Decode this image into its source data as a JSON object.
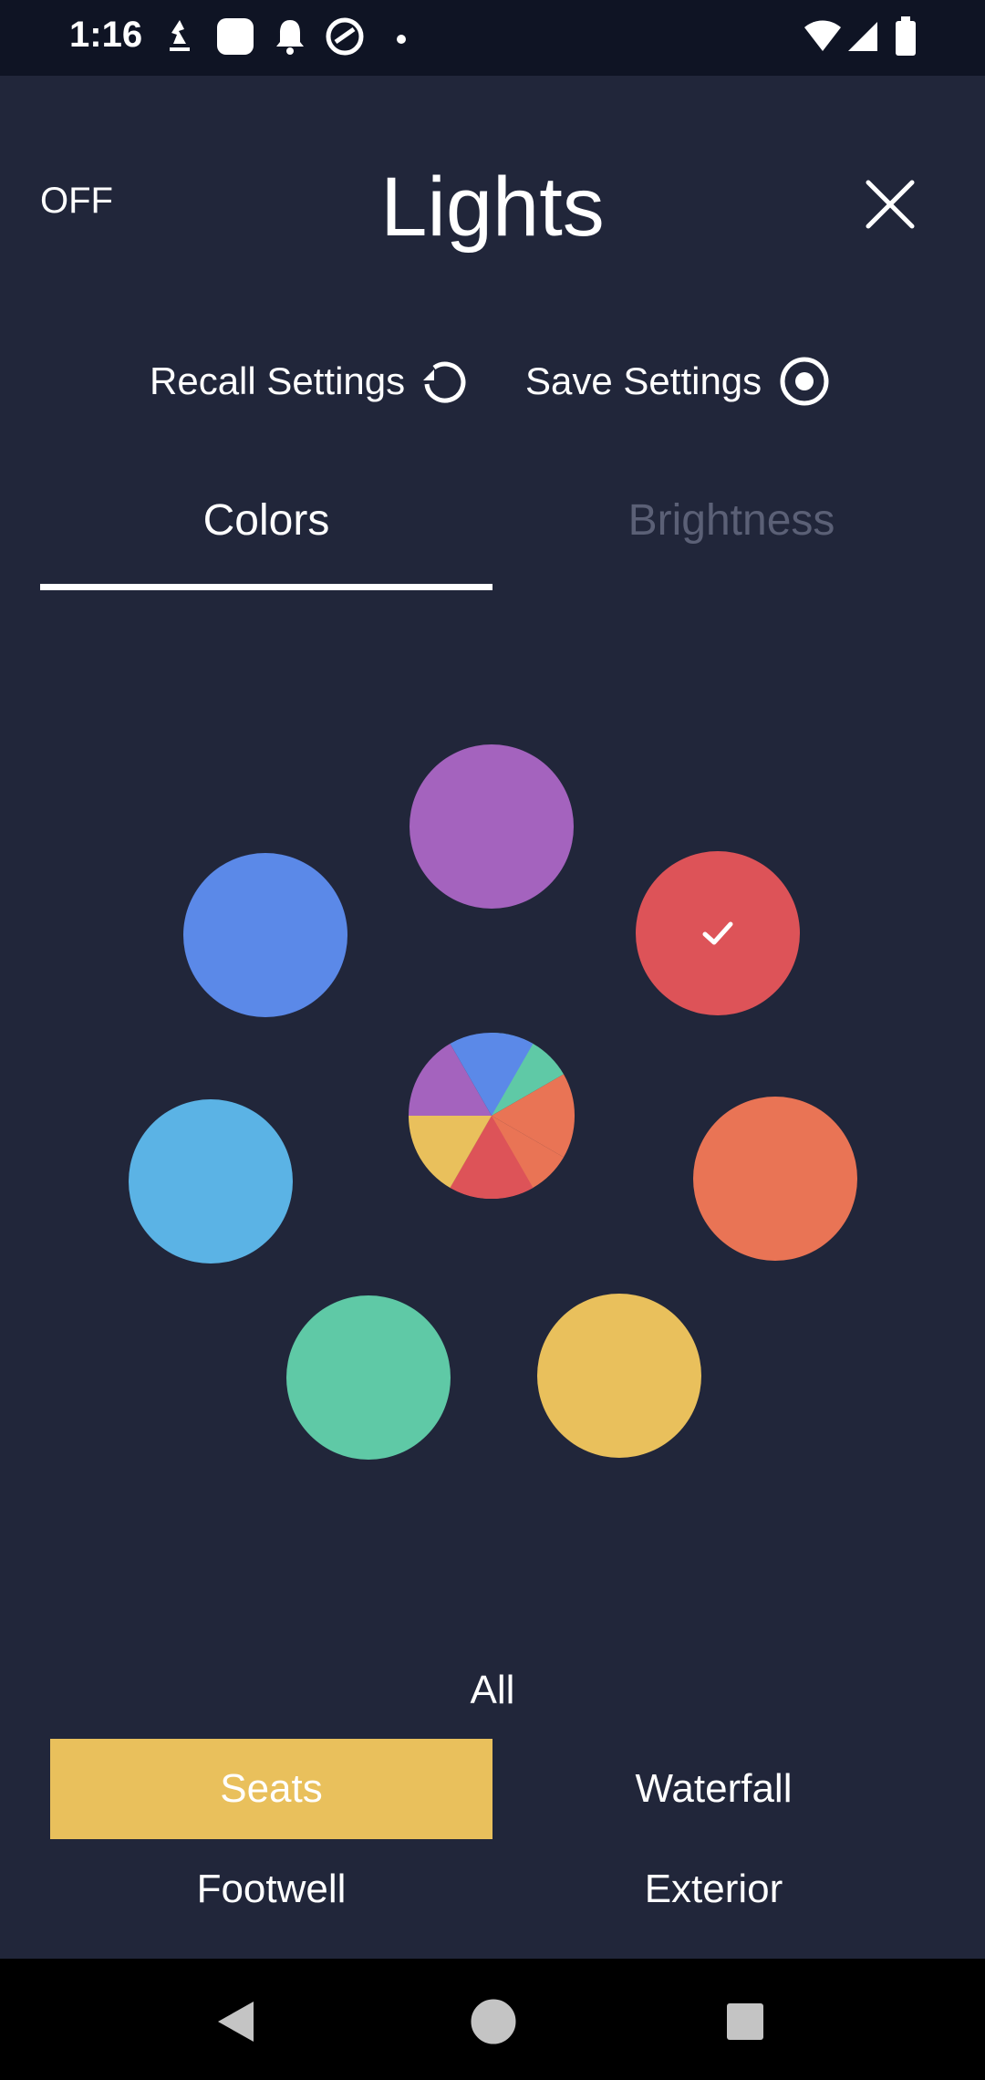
{
  "status_bar": {
    "time": "1:16"
  },
  "header": {
    "off_label": "OFF",
    "title": "Lights"
  },
  "actions": {
    "recall_label": "Recall Settings",
    "save_label": "Save Settings"
  },
  "tabs": [
    {
      "label": "Colors",
      "selected": true
    },
    {
      "label": "Brightness",
      "selected": false
    }
  ],
  "colors": {
    "background": "#21263a",
    "status_bar": "#0f1424",
    "accent": "#e9c05c",
    "purple": "#a463be",
    "blue": "#5b89e8",
    "red": "#dd5358",
    "light_blue": "#5bb3e5",
    "orange": "#e97455",
    "green": "#5fc9a6",
    "yellow": "#e9c05c"
  },
  "swatches": [
    {
      "name": "purple",
      "selected": false
    },
    {
      "name": "blue",
      "selected": false
    },
    {
      "name": "red",
      "selected": true
    },
    {
      "name": "light-blue",
      "selected": false
    },
    {
      "name": "orange",
      "selected": false
    },
    {
      "name": "green",
      "selected": false
    },
    {
      "name": "yellow",
      "selected": false
    },
    {
      "name": "multicolor",
      "selected": false
    }
  ],
  "zones": {
    "all_label": "All",
    "seats_label": "Seats",
    "waterfall_label": "Waterfall",
    "footwell_label": "Footwell",
    "exterior_label": "Exterior",
    "selected": "Seats"
  }
}
